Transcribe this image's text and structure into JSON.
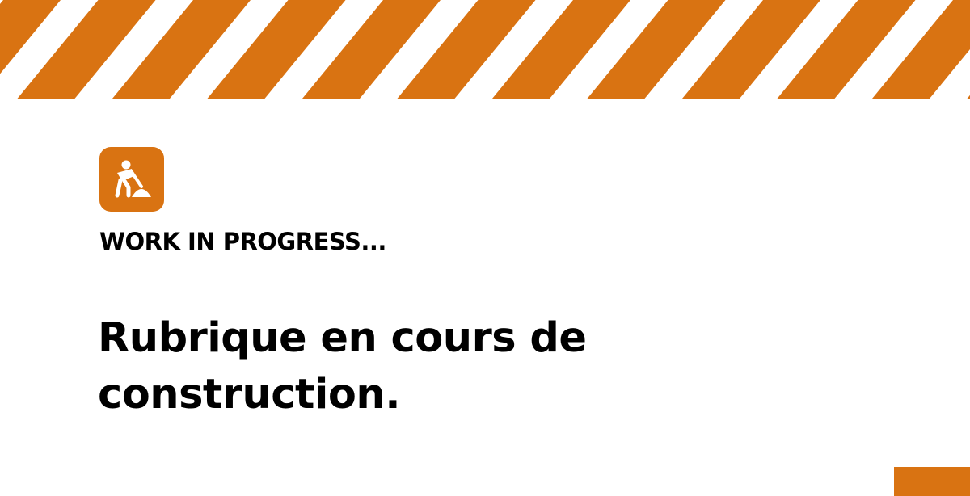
{
  "theme": {
    "accent": "#d97312",
    "background": "#ffffff",
    "text": "#000000"
  },
  "banner": {
    "pattern": "diagonal-hazard-stripes",
    "colors": [
      "#d97312",
      "#ffffff"
    ]
  },
  "badge": {
    "icon": "construction-worker-icon"
  },
  "content": {
    "eyebrow": "WORK IN PROGRESS...",
    "headline": "Rubrique en cours de construction."
  }
}
